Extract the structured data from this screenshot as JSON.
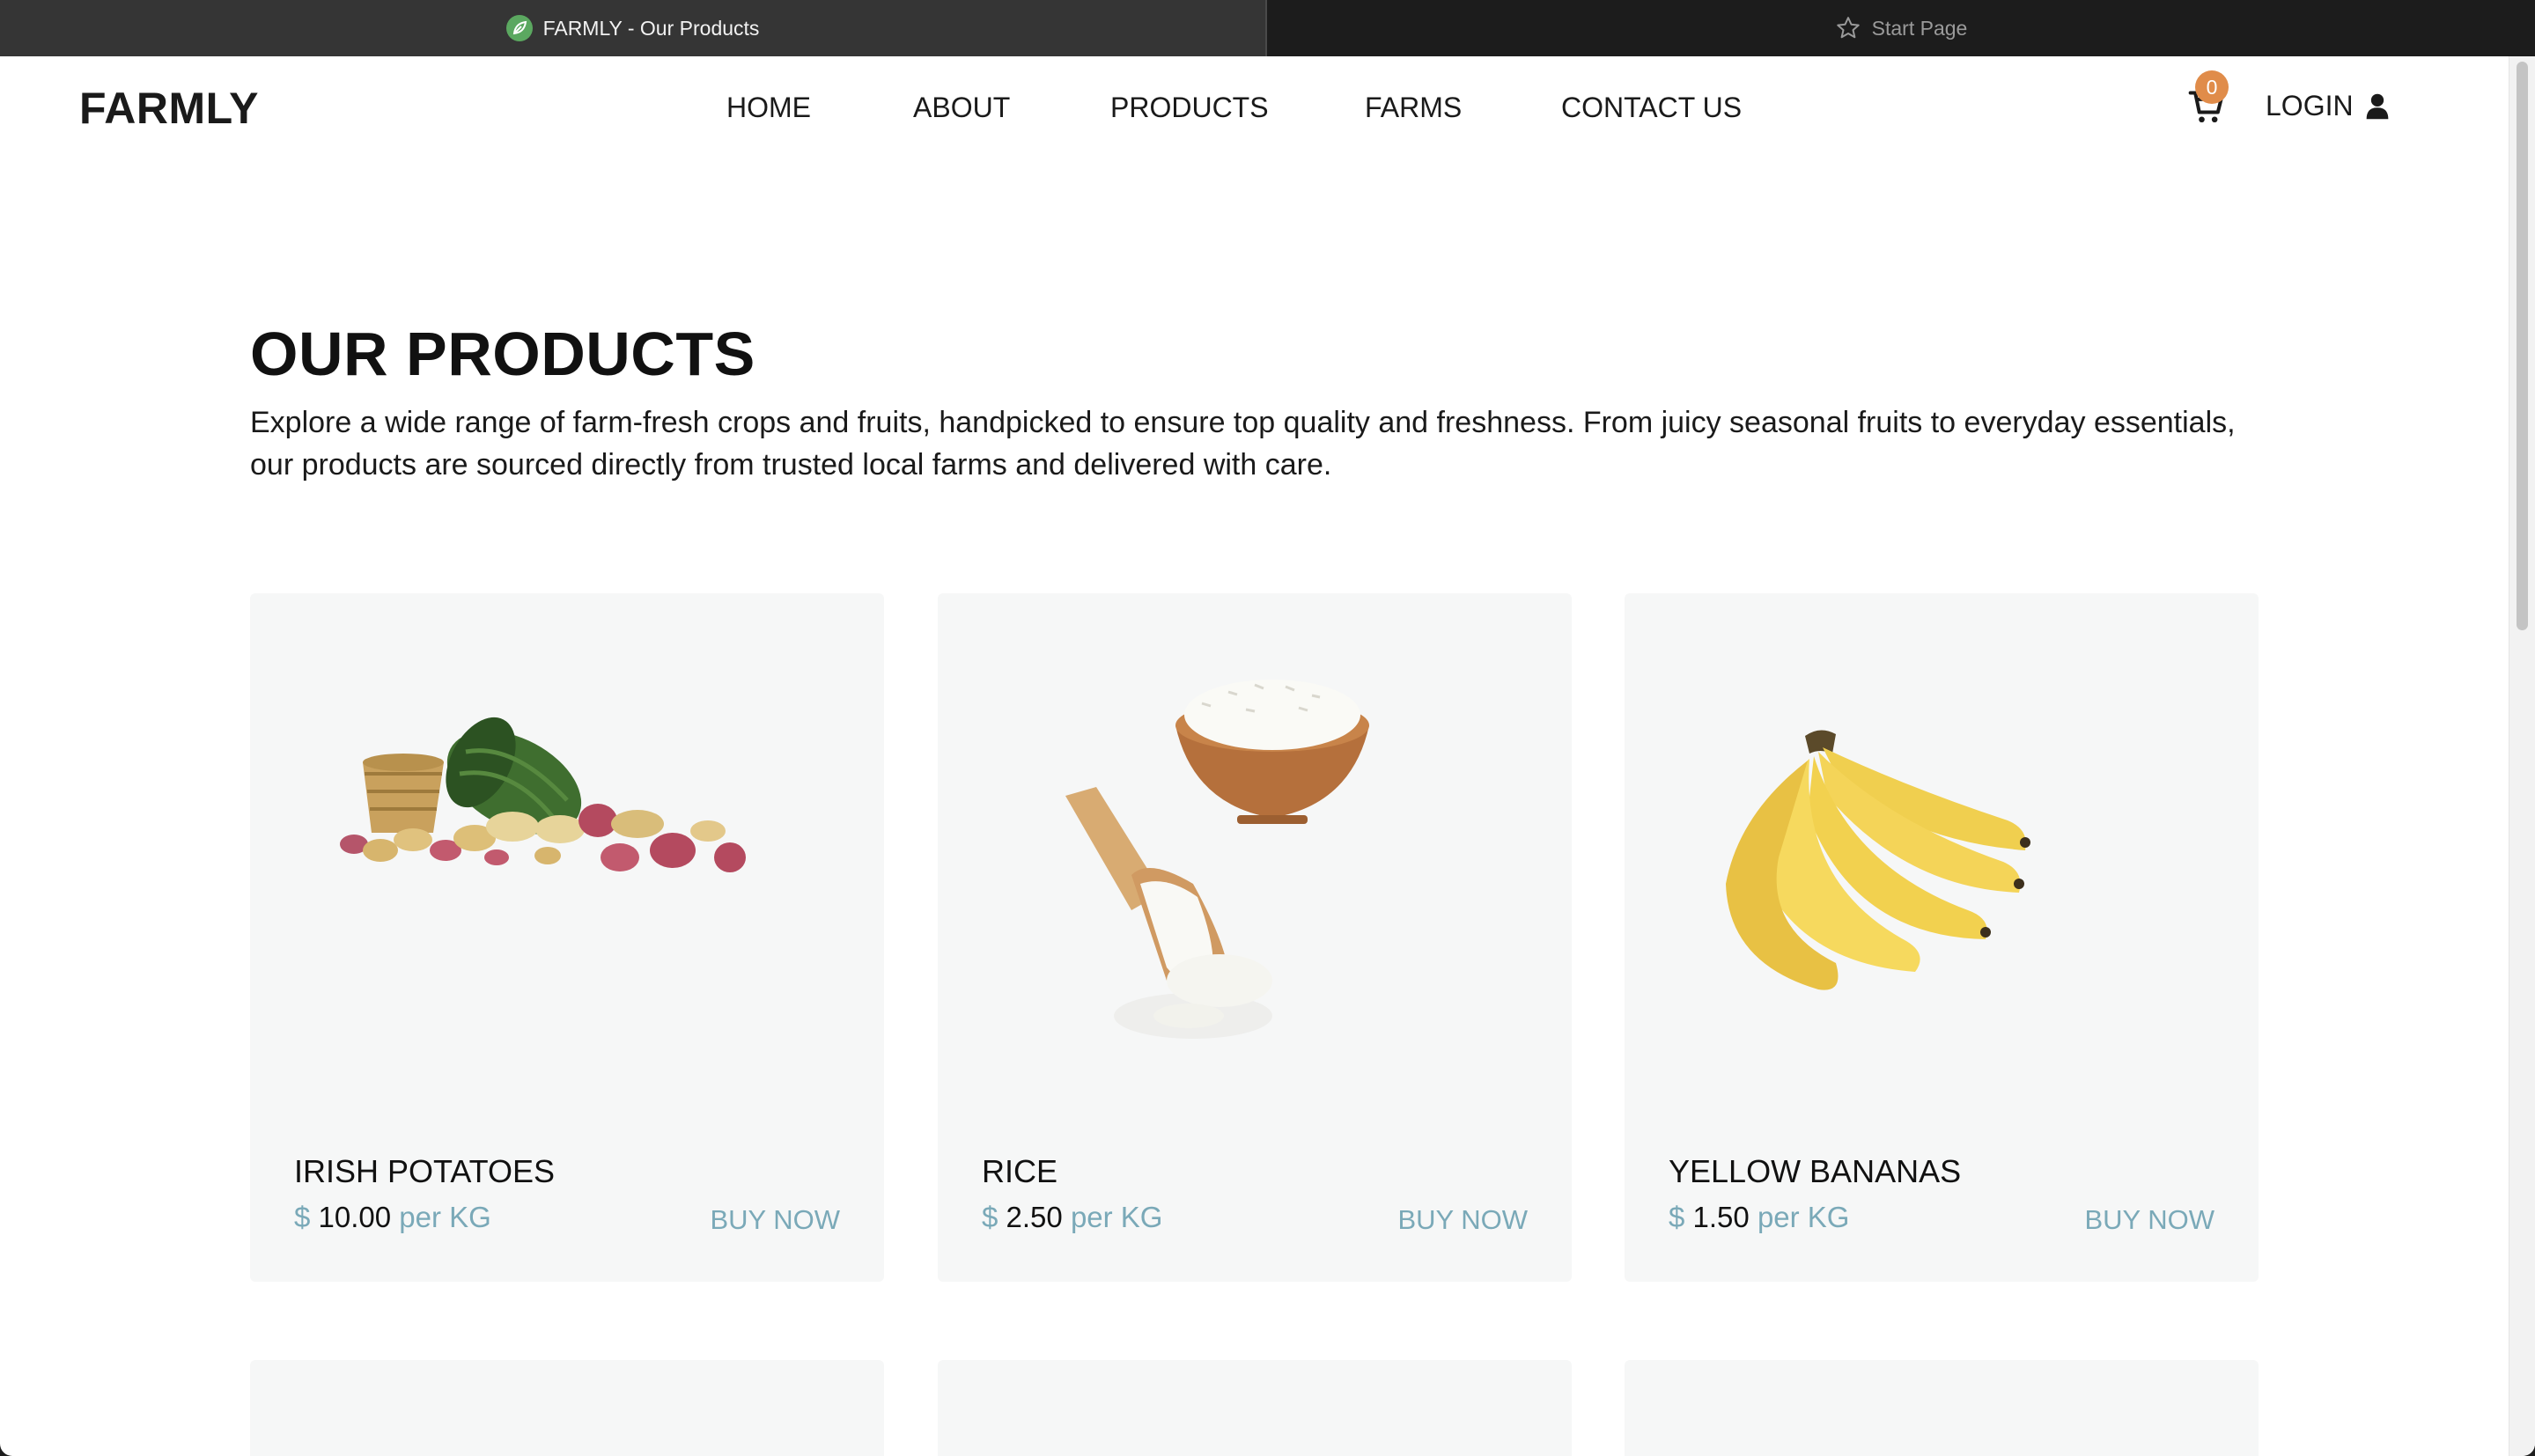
{
  "browser": {
    "active_tab": "FARMLY - Our Products",
    "inactive_tab": "Start Page"
  },
  "header": {
    "logo": "FARMLY",
    "nav": [
      "HOME",
      "ABOUT",
      "PRODUCTS",
      "FARMS",
      "CONTACT US"
    ],
    "cart_count": "0",
    "login_label": "LOGIN"
  },
  "main": {
    "title": "OUR PRODUCTS",
    "intro": "Explore a wide range of farm-fresh crops and fruits, handpicked to ensure top quality and freshness. From juicy seasonal fruits to everyday essentials, our products are sourced directly from trusted local farms and delivered with care."
  },
  "products": [
    {
      "name": "IRISH POTATOES",
      "currency": "$",
      "price": "10.00",
      "unit": "per KG",
      "cta": "BUY NOW"
    },
    {
      "name": "RICE",
      "currency": "$",
      "price": "2.50",
      "unit": "per KG",
      "cta": "BUY NOW"
    },
    {
      "name": "YELLOW BANANAS",
      "currency": "$",
      "price": "1.50",
      "unit": "per KG",
      "cta": "BUY NOW"
    }
  ],
  "colors": {
    "accent": "#7aa9b8",
    "cart_badge": "#e08c4a",
    "card_background": "#f6f7f7",
    "favicon": "#5ba860"
  },
  "icons": [
    "leaf-favicon-icon",
    "star-icon",
    "cart-icon",
    "user-icon"
  ]
}
